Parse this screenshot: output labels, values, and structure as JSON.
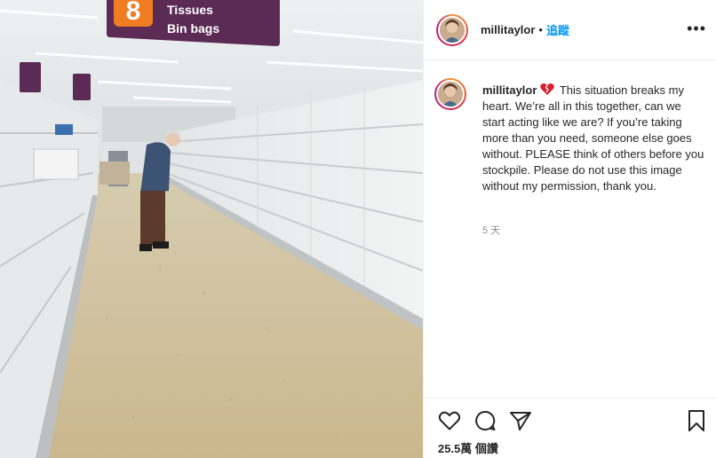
{
  "photo": {
    "aisle_sign": {
      "number": "8",
      "line1": "Tissues",
      "line2": "Bin bags"
    }
  },
  "post": {
    "username": "millitaylor",
    "separator": "•",
    "follow_label": "追蹤",
    "more_label": "•••",
    "caption": "This situation breaks my heart. We’re all in this together, can we start acting like we are? If you’re taking more than you need, someone else goes without. PLEASE think of others before you stockpile. Please do not use this image without my permission, thank you.",
    "timestamp": "5 天",
    "views": "25.5萬 個讚"
  },
  "icons": {
    "heart_emoji": "broken-heart-icon",
    "like": "heart-outline-icon",
    "comment": "comment-bubble-icon",
    "share": "paper-plane-icon",
    "save": "bookmark-icon"
  },
  "colors": {
    "follow": "#0095f6",
    "timestamp": "#8e8e8e",
    "sign_purple": "#5b2b55",
    "sign_orange": "#f07d22",
    "emoji_red": "#d8202f"
  }
}
